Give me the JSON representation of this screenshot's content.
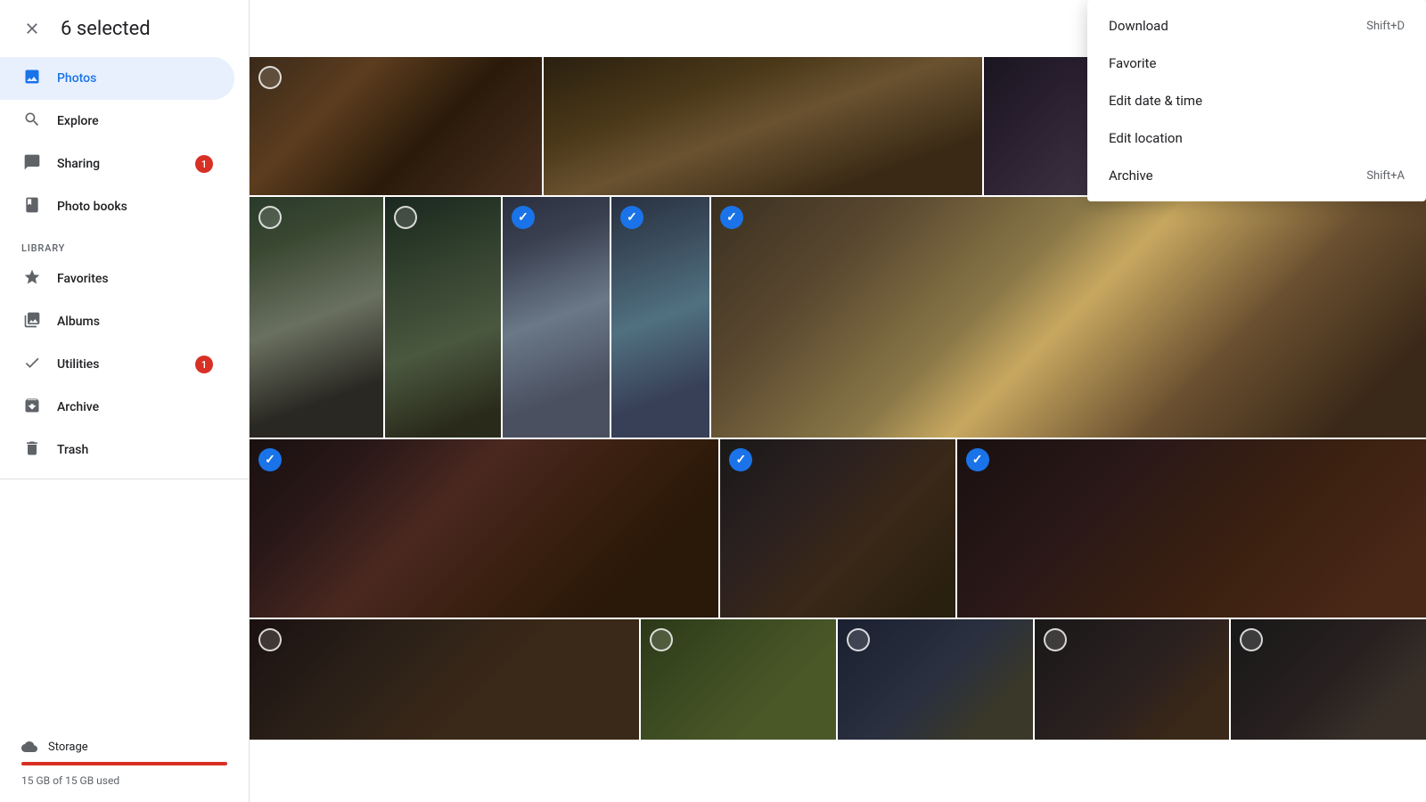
{
  "sidebar": {
    "selected_count": "6 selected",
    "nav_items": [
      {
        "id": "photos",
        "label": "Photos",
        "icon": "🖼",
        "active": true,
        "badge": null
      },
      {
        "id": "explore",
        "label": "Explore",
        "icon": "🔍",
        "active": false,
        "badge": null
      },
      {
        "id": "sharing",
        "label": "Sharing",
        "icon": "💬",
        "active": false,
        "badge": "1"
      },
      {
        "id": "photo-books",
        "label": "Photo books",
        "icon": "📖",
        "active": false,
        "badge": null
      }
    ],
    "library_label": "LIBRARY",
    "library_items": [
      {
        "id": "favorites",
        "label": "Favorites",
        "icon": "★",
        "badge": null
      },
      {
        "id": "albums",
        "label": "Albums",
        "icon": "🖼",
        "badge": null
      },
      {
        "id": "utilities",
        "label": "Utilities",
        "icon": "✓",
        "badge": "1"
      },
      {
        "id": "archive",
        "label": "Archive",
        "icon": "⬇",
        "badge": null
      },
      {
        "id": "trash",
        "label": "Trash",
        "icon": "🗑",
        "badge": null
      }
    ],
    "storage": {
      "label": "Storage",
      "icon": "☁",
      "used_text": "15 GB of 15 GB used",
      "percent": 100
    }
  },
  "header": {
    "share_icon": "share",
    "more_icon": "more_vert"
  },
  "context_menu": {
    "items": [
      {
        "id": "download",
        "label": "Download",
        "shortcut": "Shift+D"
      },
      {
        "id": "favorite",
        "label": "Favorite",
        "shortcut": ""
      },
      {
        "id": "edit-date-time",
        "label": "Edit date & time",
        "shortcut": ""
      },
      {
        "id": "edit-location",
        "label": "Edit location",
        "shortcut": ""
      },
      {
        "id": "archive",
        "label": "Archive",
        "shortcut": "Shift+A"
      }
    ]
  }
}
